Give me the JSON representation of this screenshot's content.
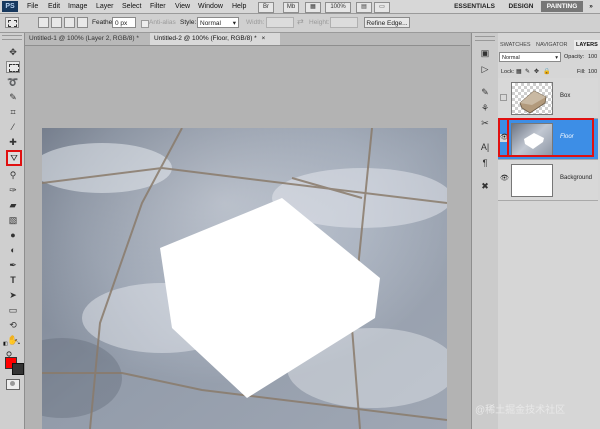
{
  "app": {
    "logo": "PS",
    "menu": [
      "File",
      "Edit",
      "Image",
      "Layer",
      "Select",
      "Filter",
      "View",
      "Window",
      "Help"
    ],
    "menubar_widgets": {
      "br": "Br",
      "mb": "Mb",
      "zoom": "100%"
    },
    "workspaces": {
      "essentials": "ESSENTIALS",
      "design": "DESIGN",
      "painting": "PAINTING",
      "more": "»"
    }
  },
  "options": {
    "feather_label": "Feather:",
    "feather_value": "0 px",
    "anti_alias_label": "Anti-alias",
    "style_label": "Style:",
    "style_value": "Normal",
    "width_label": "Width:",
    "height_label": "Height:",
    "refine_edge": "Refine Edge..."
  },
  "documents": {
    "tabs": [
      {
        "label": "Untitled-1 @ 100% (Layer 2, RGB/8) *"
      },
      {
        "label": "Untitled-2 @ 100% (Floor, RGB/8) *"
      }
    ]
  },
  "panel": {
    "tabs": {
      "swatches": "SWATCHES",
      "navigator": "NAVIGATOR",
      "layers": "LAYERS"
    },
    "blend_mode": "Normal",
    "opacity_label": "Opacity:",
    "opacity_value": "100",
    "lock_label": "Lock:",
    "fill_label": "Fill:",
    "fill_value": "100",
    "layers": [
      {
        "name": "Box",
        "visible": false,
        "selected": false
      },
      {
        "name": "Floor",
        "visible": true,
        "selected": true
      },
      {
        "name": "Background",
        "visible": true,
        "selected": false
      }
    ]
  },
  "colors": {
    "foreground": "#ff0000",
    "background": "#333333",
    "highlight": "#e01010",
    "selected_layer": "#3d8ee6"
  },
  "watermark": "@稀土掘金技术社区"
}
